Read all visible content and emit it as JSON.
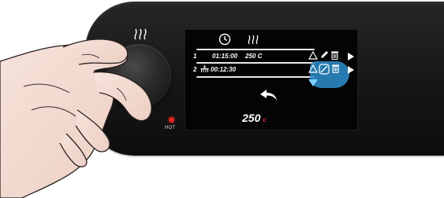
{
  "colors": {
    "panel": "#1a1a1a",
    "screen": "#040404",
    "accent_red": "#d21e1e",
    "highlight_blue": "#2e8fcf",
    "text": "#ffffff"
  },
  "panel": {
    "hot_label": "HOT",
    "top_icon": "heat-waves-icon"
  },
  "screen": {
    "header_icons": [
      "clock-icon",
      "heat-waves-icon"
    ],
    "rows": [
      {
        "index": "1",
        "time": "01:15:00",
        "temp": "250 C",
        "icons": [
          "triangle-up-icon",
          "pencil-icon",
          "trash-icon",
          "play-icon"
        ]
      },
      {
        "index": "2",
        "time": "00:12:30",
        "icons": [
          "fan-icon",
          "triangle-up-icon",
          "no-edit-icon",
          "trash-icon",
          "play-icon"
        ]
      }
    ],
    "back_icon": "back-arrow-icon",
    "temperature": {
      "value": "250",
      "unit": "c"
    }
  }
}
